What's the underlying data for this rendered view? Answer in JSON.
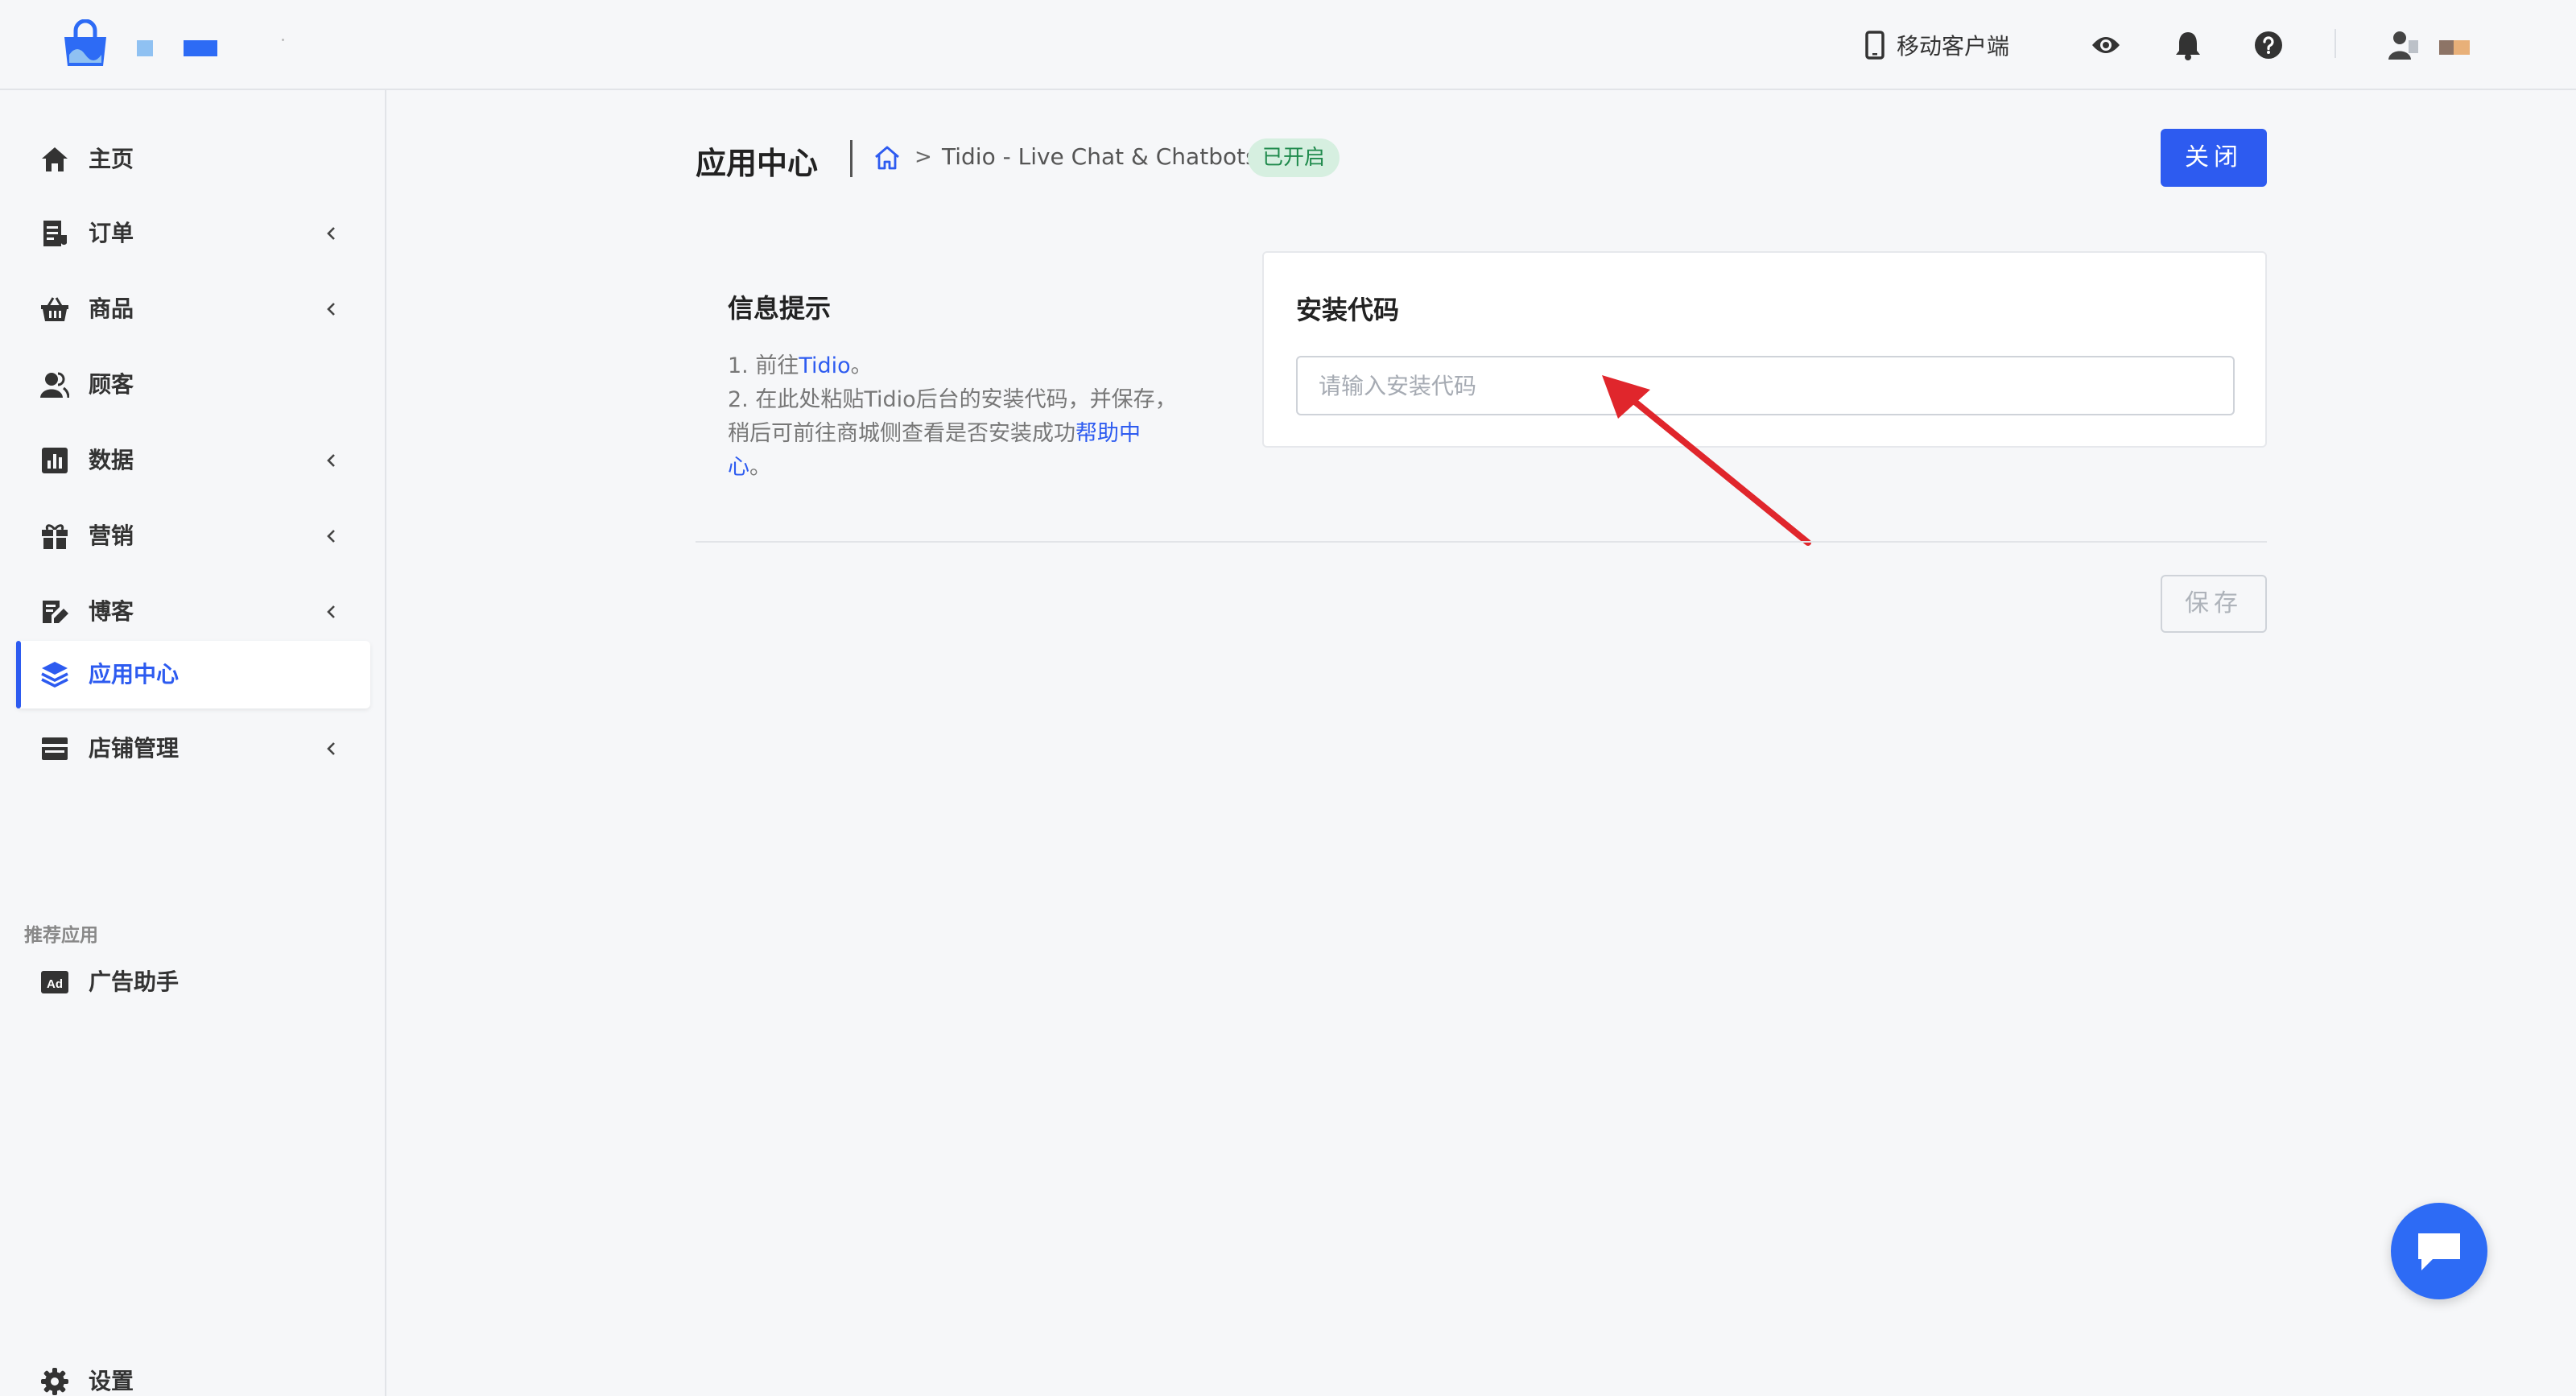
{
  "header": {
    "mobile_label": "移动客户端"
  },
  "sidebar": {
    "items": [
      {
        "label": "主页"
      },
      {
        "label": "订单"
      },
      {
        "label": "商品"
      },
      {
        "label": "顾客"
      },
      {
        "label": "数据"
      },
      {
        "label": "营销"
      },
      {
        "label": "博客"
      },
      {
        "label": "应用中心"
      },
      {
        "label": "店铺管理"
      }
    ],
    "section_label": "推荐应用",
    "recommended": [
      {
        "label": "广告助手"
      }
    ],
    "settings_label": "设置"
  },
  "page": {
    "title": "应用中心",
    "breadcrumb_separator": ">",
    "breadcrumb_app": "Tidio - Live Chat & Chatbots",
    "status": "已开启",
    "close_label": "关闭"
  },
  "info": {
    "title": "信息提示",
    "line1_prefix": "1. 前往",
    "line1_link": "Tidio",
    "line1_suffix": "。",
    "line2": "2. 在此处粘贴Tidio后台的安装代码，并保存，稍后可前往商城侧查看是否安装成功",
    "line2_link": "帮助中心",
    "line2_suffix": "。"
  },
  "install": {
    "title": "安装代码",
    "placeholder": "请输入安装代码",
    "value": ""
  },
  "footer": {
    "save_label": "保存"
  },
  "colors": {
    "accent": "#2d5bf0",
    "status_bg": "#d6efe0",
    "status_text": "#1f8a4c",
    "arrow": "#e0262c"
  }
}
